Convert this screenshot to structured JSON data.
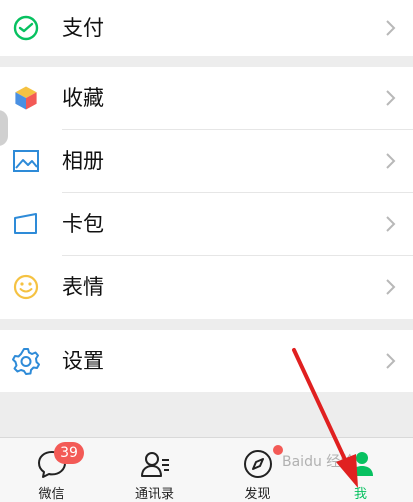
{
  "menu": {
    "pay": {
      "label": "支付",
      "icon": "payment-icon"
    },
    "favorites": {
      "label": "收藏",
      "icon": "favorites-cube-icon"
    },
    "album": {
      "label": "相册",
      "icon": "album-image-icon"
    },
    "cards": {
      "label": "卡包",
      "icon": "card-wallet-icon"
    },
    "stickers": {
      "label": "表情",
      "icon": "smiley-icon"
    },
    "settings": {
      "label": "设置",
      "icon": "gear-icon"
    }
  },
  "tabbar": {
    "chats": {
      "label": "微信",
      "badge": "39"
    },
    "contacts": {
      "label": "通讯录"
    },
    "discover": {
      "label": "发现"
    },
    "me": {
      "label": "我"
    }
  },
  "colors": {
    "accent_green": "#07c160",
    "badge_red": "#f35a56",
    "annotation_arrow": "#e02020"
  },
  "watermark": "Baidu 经验"
}
